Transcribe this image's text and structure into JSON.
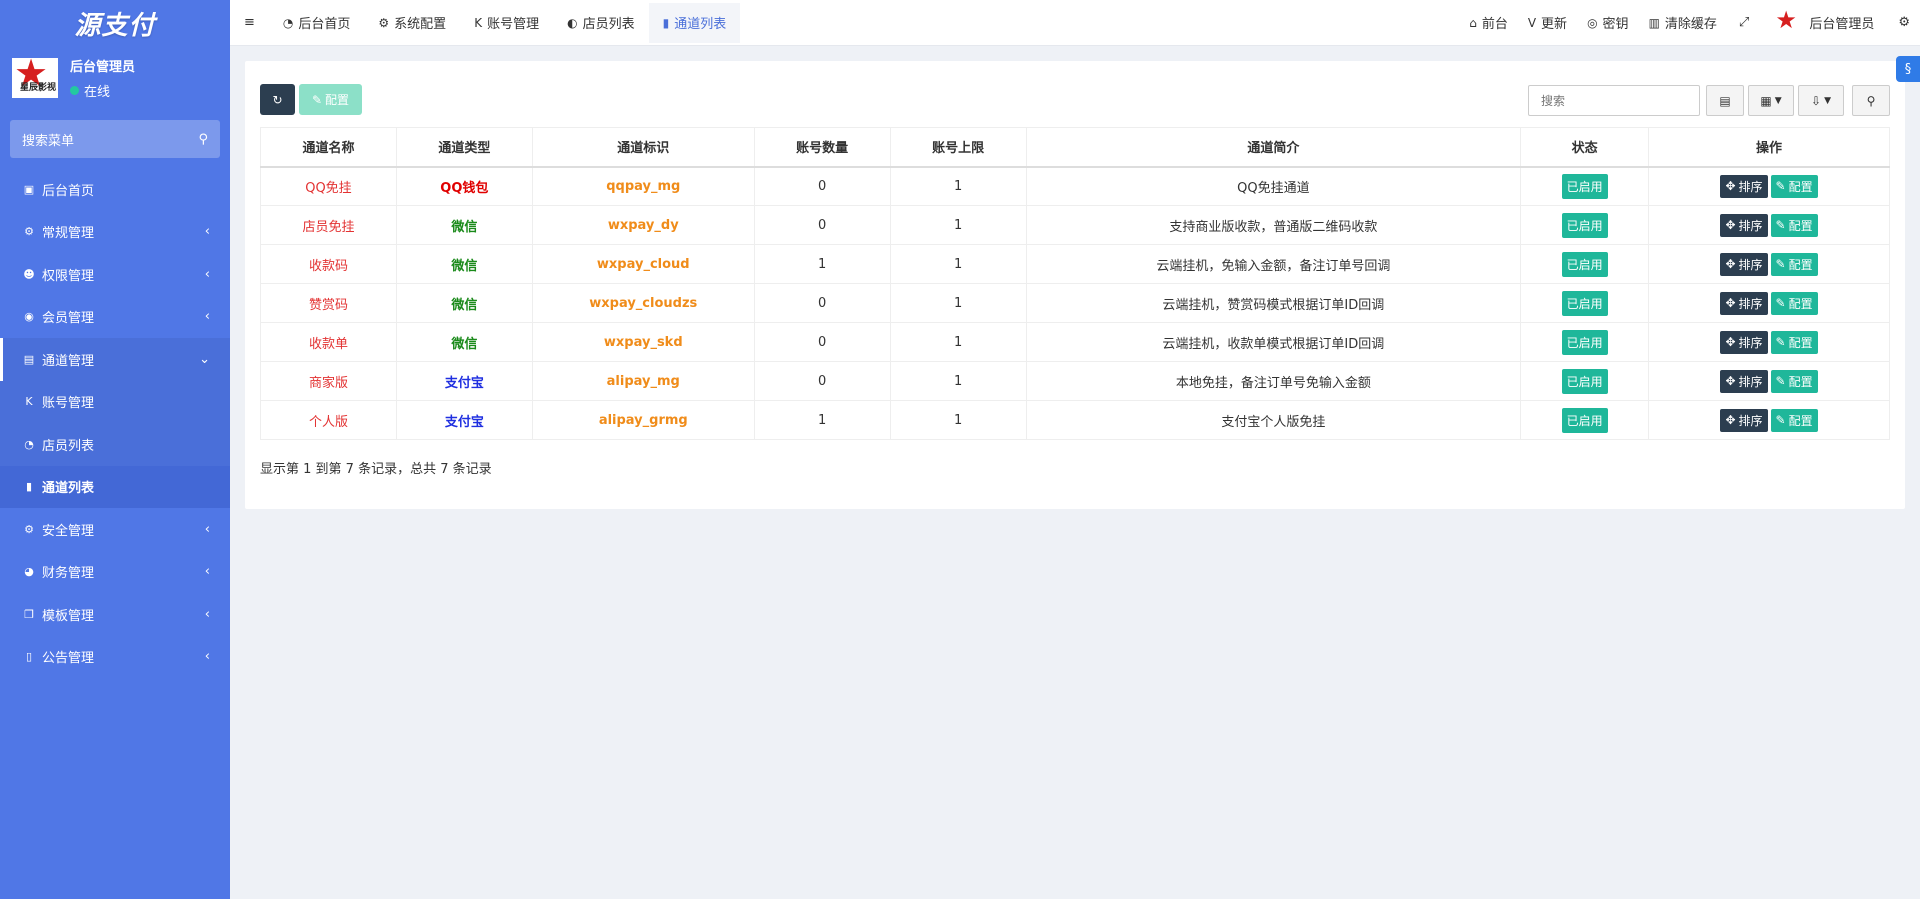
{
  "brand": {
    "logo_text": "源支付"
  },
  "user": {
    "name": "后台管理员",
    "status": "在线",
    "avatar_text": "星辰影视"
  },
  "sidebar": {
    "search_placeholder": "搜索菜单",
    "items": [
      {
        "icon": "▣",
        "label": "后台首页",
        "arrow": ""
      },
      {
        "icon": "⚙",
        "label": "常规管理",
        "arrow": "‹"
      },
      {
        "icon": "☻",
        "label": "权限管理",
        "arrow": "‹"
      },
      {
        "icon": "◉",
        "label": "会员管理",
        "arrow": "‹"
      },
      {
        "icon": "▤",
        "label": "通道管理",
        "arrow": "⌄"
      },
      {
        "icon": "K",
        "label": "账号管理",
        "arrow": ""
      },
      {
        "icon": "◔",
        "label": "店员列表",
        "arrow": ""
      },
      {
        "icon": "▮",
        "label": "通道列表",
        "arrow": ""
      },
      {
        "icon": "⚙",
        "label": "安全管理",
        "arrow": "‹"
      },
      {
        "icon": "◕",
        "label": "财务管理",
        "arrow": "‹"
      },
      {
        "icon": "❐",
        "label": "模板管理",
        "arrow": "‹"
      },
      {
        "icon": "▯",
        "label": "公告管理",
        "arrow": "‹"
      }
    ]
  },
  "topbar": {
    "tabs": [
      {
        "icon": "◔",
        "label": "后台首页"
      },
      {
        "icon": "⚙",
        "label": "系统配置"
      },
      {
        "icon": "K",
        "label": "账号管理"
      },
      {
        "icon": "◐",
        "label": "店员列表"
      },
      {
        "icon": "▮",
        "label": "通道列表"
      }
    ],
    "right": [
      {
        "icon": "⌂",
        "label": "前台"
      },
      {
        "icon": "V",
        "label": "更新"
      },
      {
        "icon": "◎",
        "label": "密钥"
      },
      {
        "icon": "▥",
        "label": "清除缓存"
      }
    ],
    "admin_name": "后台管理员"
  },
  "toolbar": {
    "config_label": "配置",
    "search_placeholder": "搜索"
  },
  "table": {
    "headers": [
      "通道名称",
      "通道类型",
      "通道标识",
      "账号数量",
      "账号上限",
      "通道简介",
      "状态",
      "操作"
    ],
    "rows": [
      {
        "name": "QQ免挂",
        "type": "QQ钱包",
        "type_class": "t-qq",
        "ident": "qqpay_mg",
        "count": "0",
        "limit": "1",
        "desc": "QQ免挂通道",
        "status": "已启用"
      },
      {
        "name": "店员免挂",
        "type": "微信",
        "type_class": "t-wx",
        "ident": "wxpay_dy",
        "count": "0",
        "limit": "1",
        "desc": "支持商业版收款，普通版二维码收款",
        "status": "已启用"
      },
      {
        "name": "收款码",
        "type": "微信",
        "type_class": "t-wx",
        "ident": "wxpay_cloud",
        "count": "1",
        "limit": "1",
        "desc": "云端挂机，免输入金额，备注订单号回调",
        "status": "已启用"
      },
      {
        "name": "赞赏码",
        "type": "微信",
        "type_class": "t-wx",
        "ident": "wxpay_cloudzs",
        "count": "0",
        "limit": "1",
        "desc": "云端挂机，赞赏码模式根据订单ID回调",
        "status": "已启用"
      },
      {
        "name": "收款单",
        "type": "微信",
        "type_class": "t-wx",
        "ident": "wxpay_skd",
        "count": "0",
        "limit": "1",
        "desc": "云端挂机，收款单模式根据订单ID回调",
        "status": "已启用"
      },
      {
        "name": "商家版",
        "type": "支付宝",
        "type_class": "t-ali",
        "ident": "alipay_mg",
        "count": "0",
        "limit": "1",
        "desc": "本地免挂，备注订单号免输入金额",
        "status": "已启用"
      },
      {
        "name": "个人版",
        "type": "支付宝",
        "type_class": "t-ali",
        "ident": "alipay_grmg",
        "count": "1",
        "limit": "1",
        "desc": "支付宝个人版免挂",
        "status": "已启用"
      }
    ],
    "sort_label": "排序",
    "config_label": "配置"
  },
  "summary": "显示第 1 到第 7 条记录，总共 7 条记录"
}
